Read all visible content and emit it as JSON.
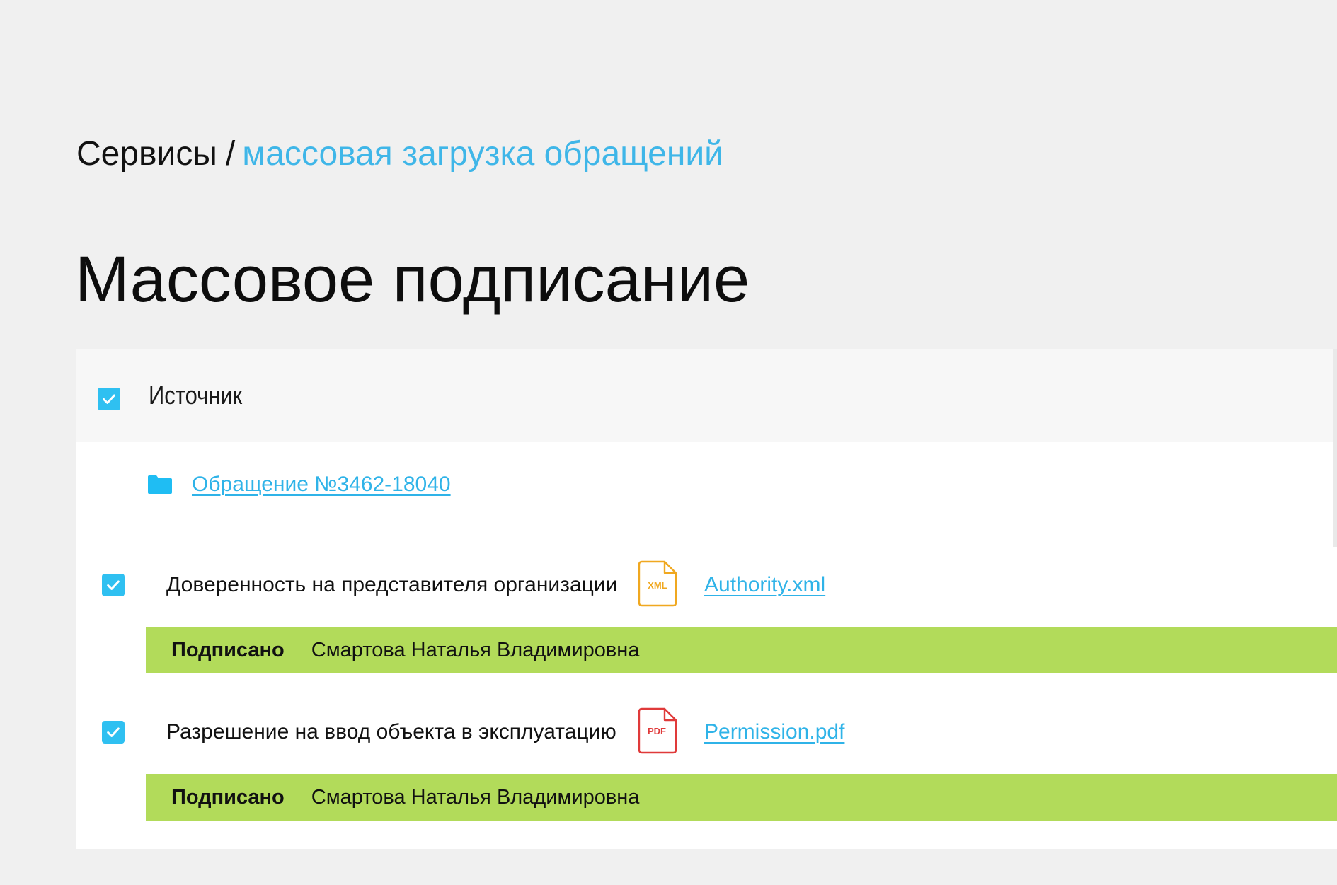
{
  "breadcrumb": {
    "root": "Сервисы",
    "separator": "/",
    "current": "массовая загрузка обращений"
  },
  "page_title": "Массовое подписание",
  "table": {
    "header": {
      "checked": true,
      "label": "Источник"
    },
    "folder": {
      "icon": "folder-icon",
      "link": "Обращение №3462-18040"
    },
    "documents": [
      {
        "checked": true,
        "title": "Доверенность на представителя организации",
        "file_type": "XML",
        "file_icon_color": "#f0a820",
        "file_name": "Authority.xml",
        "status_label": "Подписано",
        "signer": "Смартова Наталья Владимировна"
      },
      {
        "checked": true,
        "title": "Разрешение на ввод объекта в эксплуатацию",
        "file_type": "PDF",
        "file_icon_color": "#e03a3a",
        "file_name": "Permission.pdf",
        "status_label": "Подписано",
        "signer": "Смартова Наталья Владимировна"
      }
    ]
  },
  "colors": {
    "accent": "#2fc0f1",
    "link": "#2fb3e8",
    "status_signed": "#b2db5a",
    "background": "#f0f0f0"
  }
}
